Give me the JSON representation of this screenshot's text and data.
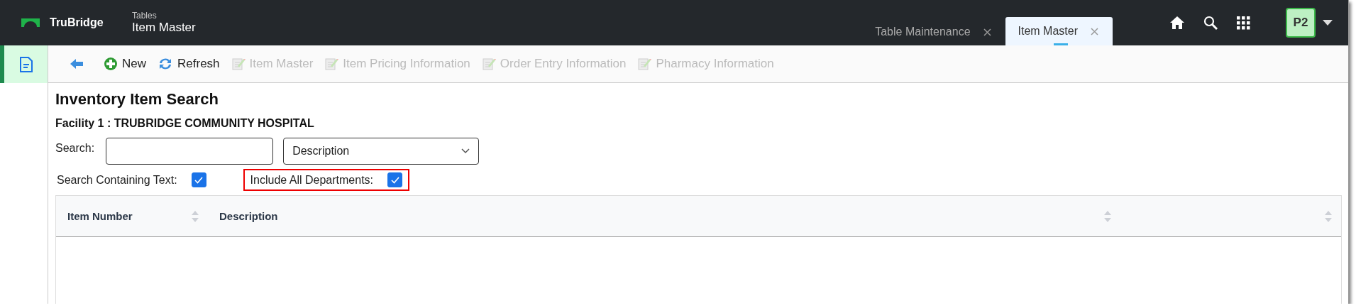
{
  "header": {
    "brand": "TruBridge",
    "module": "Tables",
    "title": "Item Master",
    "avatar": "P2"
  },
  "tabs": [
    {
      "label": "Table Maintenance",
      "selected": false
    },
    {
      "label": "Item Master",
      "selected": true
    }
  ],
  "sidebar": {
    "items": [
      {
        "kind": "document",
        "selected": true
      }
    ]
  },
  "toolbar": [
    {
      "kind": "back"
    },
    {
      "kind": "new",
      "label": "New",
      "disabled": false
    },
    {
      "kind": "refresh",
      "label": "Refresh",
      "disabled": false
    },
    {
      "kind": "edit",
      "label": "Item Master",
      "disabled": true
    },
    {
      "kind": "edit",
      "label": "Item Pricing Information",
      "disabled": true
    },
    {
      "kind": "edit",
      "label": "Order Entry Information",
      "disabled": true
    },
    {
      "kind": "edit",
      "label": "Pharmacy Information",
      "disabled": true
    }
  ],
  "page": {
    "title": "Inventory Item Search",
    "facility": "Facility 1 : TRUBRIDGE COMMUNITY HOSPITAL"
  },
  "search": {
    "label": "Search:",
    "select_value": "Description"
  },
  "options": [
    {
      "label": "Search Containing Text:",
      "checked": true,
      "highlighted": false
    },
    {
      "label": "Include All Departments:",
      "checked": true,
      "highlighted": true
    }
  ],
  "table": {
    "columns": [
      {
        "label": "Item Number"
      },
      {
        "label": "Description"
      },
      {}
    ]
  }
}
